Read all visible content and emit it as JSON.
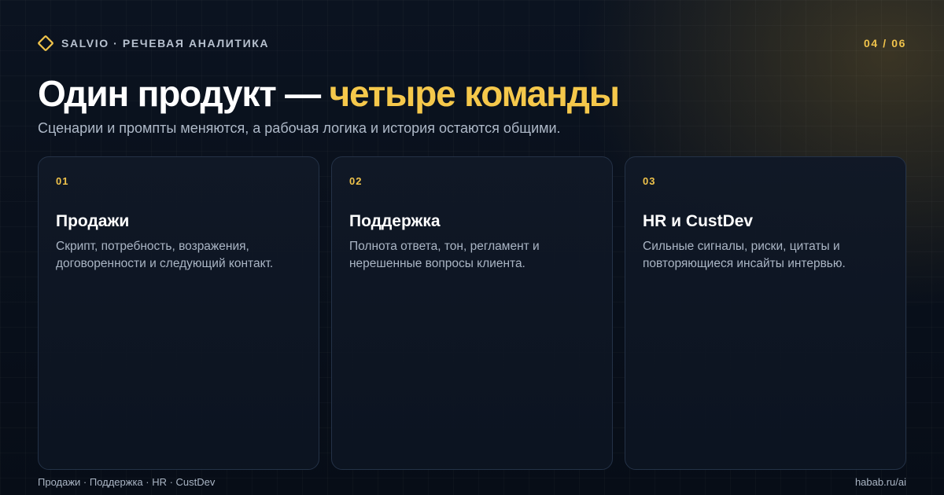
{
  "header": {
    "brand": "SALVIO · РЕЧЕВАЯ АНАЛИТИКА",
    "brand_icon": "diamond-icon",
    "page_counter": "04 / 06"
  },
  "hero": {
    "title_main": "Один продукт — ",
    "title_accent": "четыре команды",
    "subtitle": "Сценарии и промпты меняются, а рабочая логика и история остаются общими."
  },
  "cards": [
    {
      "number": "01",
      "title": "Продажи",
      "description": "Скрипт, потребность, возражения, договоренности и следующий контакт."
    },
    {
      "number": "02",
      "title": "Поддержка",
      "description": "Полнота ответа, тон, регламент и нерешенные вопросы клиента."
    },
    {
      "number": "03",
      "title": "HR и CustDev",
      "description": "Сильные сигналы, риски, цитаты и повторяющиеся инсайты интервью."
    }
  ],
  "footer": {
    "left": "Продажи · Поддержка · HR · CustDev",
    "right": "habab.ru/ai"
  },
  "colors": {
    "accent": "#f5c84b",
    "background": "#0b1320",
    "card_border": "#243247",
    "muted_text": "#aab5c4"
  }
}
